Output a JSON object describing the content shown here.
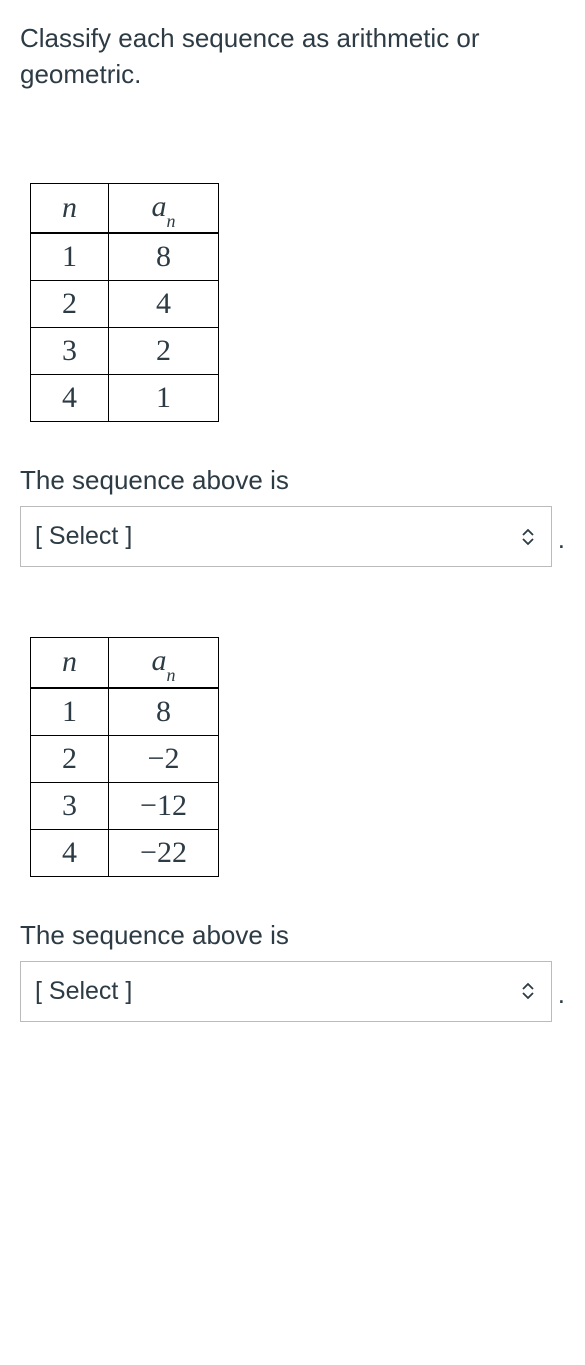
{
  "instruction": "Classify each sequence as arithmetic or geometric.",
  "tables": [
    {
      "header_n": "n",
      "header_an_base": "a",
      "header_an_sub": "n",
      "rows": [
        {
          "n": "1",
          "an": "8"
        },
        {
          "n": "2",
          "an": "4"
        },
        {
          "n": "3",
          "an": "2"
        },
        {
          "n": "4",
          "an": "1"
        }
      ]
    },
    {
      "header_n": "n",
      "header_an_base": "a",
      "header_an_sub": "n",
      "rows": [
        {
          "n": "1",
          "an": "8"
        },
        {
          "n": "2",
          "an": "−2"
        },
        {
          "n": "3",
          "an": "−12"
        },
        {
          "n": "4",
          "an": "−22"
        }
      ]
    }
  ],
  "prompt_label": "The sequence above is",
  "select_placeholder": "[ Select ]",
  "period": "."
}
